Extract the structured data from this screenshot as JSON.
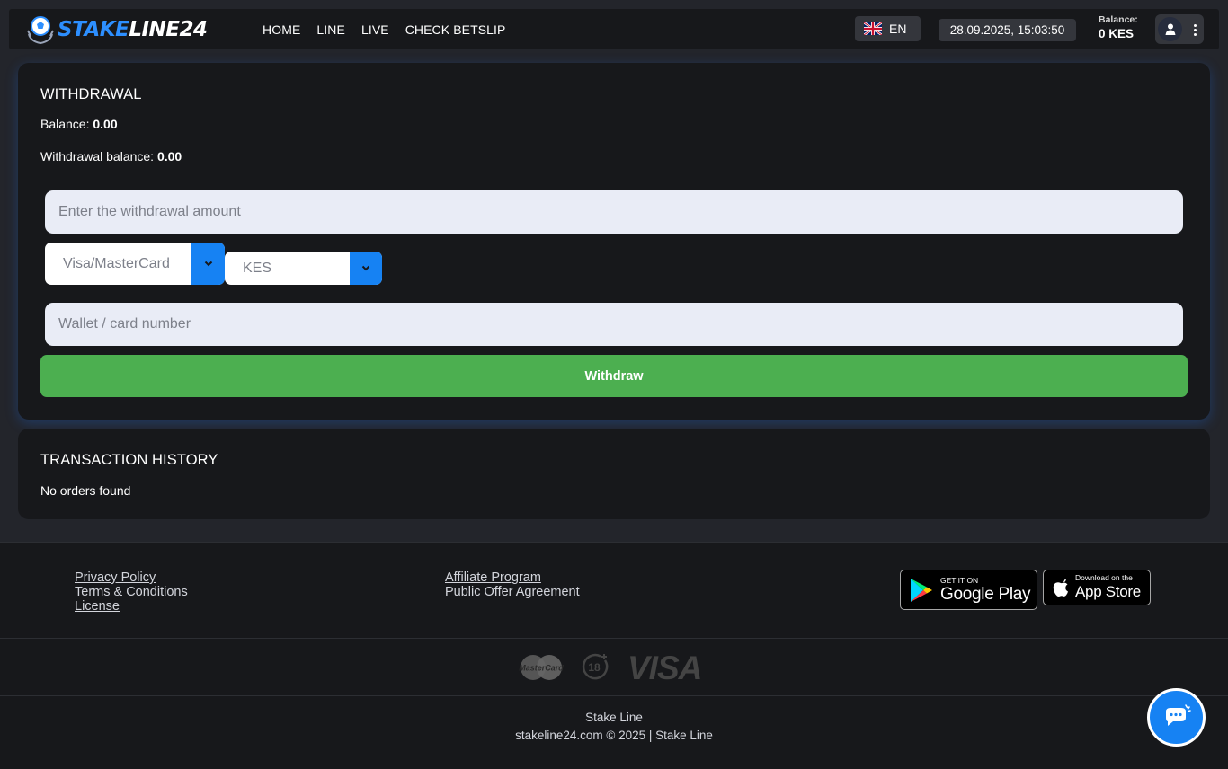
{
  "header": {
    "logo": {
      "part1": "STAKE",
      "part2": "LINE24"
    },
    "nav": [
      {
        "label": "HOME"
      },
      {
        "label": "LINE"
      },
      {
        "label": "LIVE"
      },
      {
        "label": "CHECK BETSLIP"
      }
    ],
    "language": "EN",
    "datetime": "28.09.2025, 15:03:50",
    "balance_label": "Balance:",
    "balance_value": "0 KES"
  },
  "withdrawal": {
    "title": "WITHDRAWAL",
    "balance_label": "Balance:",
    "balance_value": "0.00",
    "withdrawal_balance_label": "Withdrawal balance:",
    "withdrawal_balance_value": "0.00",
    "amount_placeholder": "Enter the withdrawal amount",
    "method_selected": "Visa/MasterCard",
    "currency_selected": "KES",
    "wallet_placeholder": "Wallet / card number",
    "submit_label": "Withdraw"
  },
  "history": {
    "title": "TRANSACTION HISTORY",
    "empty_text": "No orders found"
  },
  "footer": {
    "links_col1": [
      "Privacy Policy",
      "Terms & Conditions",
      "License"
    ],
    "links_col2": [
      "Affiliate Program",
      "Public Offer Agreement"
    ],
    "google_play": {
      "small": "GET IT ON",
      "big": "Google Play"
    },
    "app_store": {
      "small": "Download on the",
      "big": "App Store"
    },
    "payment_logos": {
      "mastercard": "MasterCard",
      "age": "18",
      "visa": "VISA"
    },
    "brand": "Stake Line",
    "copyright": "stakeline24.com © 2025 | Stake Line"
  },
  "colors": {
    "accent": "#1682f3",
    "withdraw_button": "#4caf50",
    "card_bg": "#17181b",
    "page_bg": "#23252b"
  }
}
